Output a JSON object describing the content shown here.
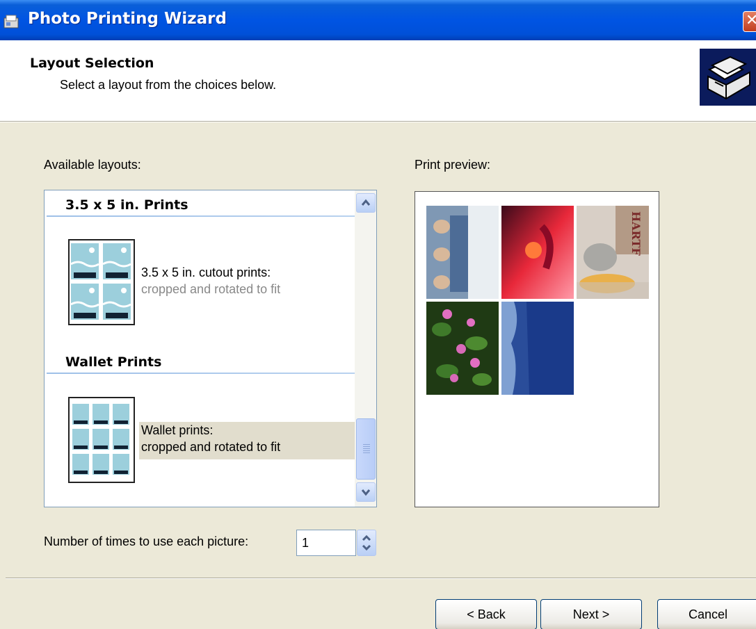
{
  "window": {
    "title": "Photo Printing Wizard",
    "close_glyph": "✕",
    "icon": "printer-wizard-icon"
  },
  "header": {
    "title": "Layout Selection",
    "subtitle": "Select a layout from the choices below.",
    "icon": "printer-photos-icon"
  },
  "layouts": {
    "label": "Available layouts:",
    "groups": [
      {
        "heading": "3.5 x 5 in. Prints",
        "items": [
          {
            "title": "3.5 x 5 in. cutout prints:",
            "desc": "cropped and rotated to fit",
            "selected": false
          }
        ]
      },
      {
        "heading": "Wallet Prints",
        "items": [
          {
            "title": "Wallet prints:",
            "desc": "cropped and rotated to fit",
            "selected": true
          }
        ]
      }
    ]
  },
  "preview": {
    "label": "Print preview:"
  },
  "copies": {
    "label": "Number of times to use each picture:",
    "value": "1"
  },
  "buttons": {
    "back": "< Back",
    "next": "Next >",
    "cancel": "Cancel"
  }
}
